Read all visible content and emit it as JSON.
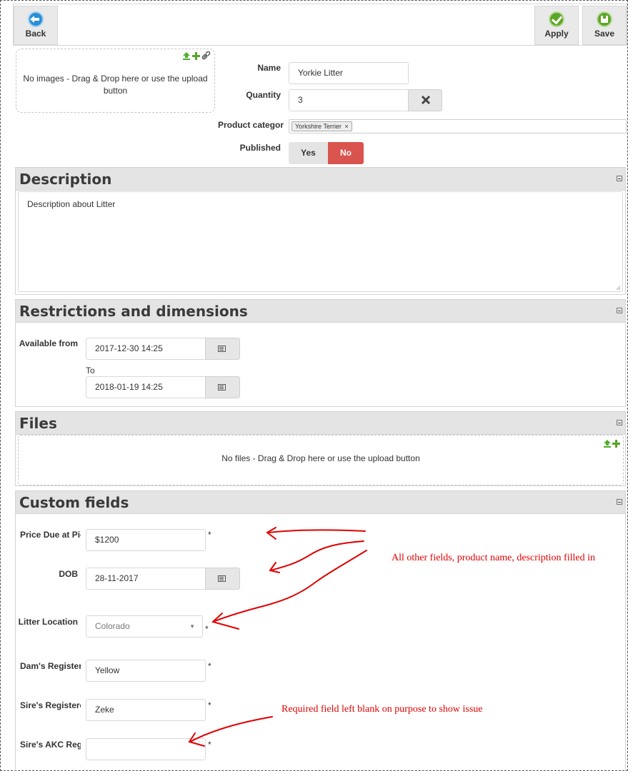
{
  "toolbar": {
    "back_label": "Back",
    "apply_label": "Apply",
    "save_label": "Save"
  },
  "images": {
    "dropzone_text": "No images - Drag & Drop here or use the upload button"
  },
  "form": {
    "name_label": "Name",
    "name_value": "Yorkie Litter",
    "quantity_label": "Quantity",
    "quantity_value": "3",
    "category_label": "Product categor",
    "category_tag": "Yorkshire Terrier",
    "published_label": "Published",
    "published_yes": "Yes",
    "published_no": "No",
    "published_selected": "No"
  },
  "description": {
    "title": "Description",
    "text": "Description about Litter"
  },
  "restrictions": {
    "title": "Restrictions and dimensions",
    "available_label": "Available from",
    "from_value": "2017-12-30 14:25",
    "to_label": "To",
    "to_value": "2018-01-19 14:25"
  },
  "files": {
    "title": "Files",
    "dropzone_text": "No files - Drag & Drop here or use the upload button"
  },
  "custom": {
    "title": "Custom fields",
    "price_label": "Price Due at Pic",
    "price_value": "$1200",
    "dob_label": "DOB",
    "dob_value": "28-11-2017",
    "location_label": "Litter Location",
    "location_value": "Colorado",
    "dam_label": "Dam's Registere",
    "dam_value": "Yellow",
    "sire_label": "Sire's Registered",
    "sire_value": "Zeke",
    "akc_label": "Sire's AKC Regis",
    "akc_value": "",
    "required_mark": "*"
  },
  "annotations": {
    "note1": "All other fields, product name, description filled in",
    "note2": "Required field left blank on purpose to show issue"
  },
  "colors": {
    "accent_no": "#d9534f",
    "annotation": "#e00000",
    "icon_green": "#5ea62a",
    "icon_blue": "#2a8fd6"
  }
}
